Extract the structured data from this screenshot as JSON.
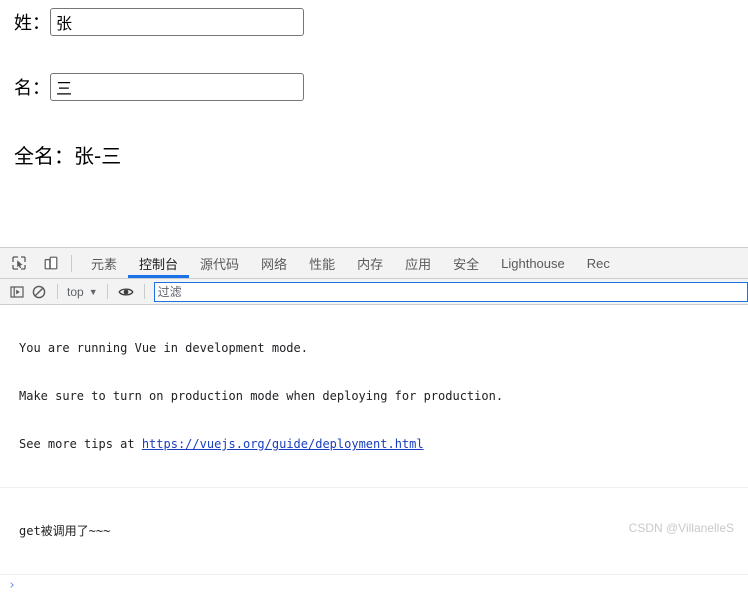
{
  "page": {
    "fields": [
      {
        "label": "姓：",
        "value": "张",
        "name": "surname"
      },
      {
        "label": "名：",
        "value": "三",
        "name": "givenname"
      }
    ],
    "fullname_text": "全名：张-三"
  },
  "devtools": {
    "toolbar_icons": [
      {
        "name": "inspect-element-icon",
        "title": "检查"
      },
      {
        "name": "device-toolbar-icon",
        "title": "切换设备工具栏"
      }
    ],
    "tabs": [
      {
        "label": "元素",
        "active": false,
        "cjk": true
      },
      {
        "label": "控制台",
        "active": true,
        "cjk": true
      },
      {
        "label": "源代码",
        "active": false,
        "cjk": true
      },
      {
        "label": "网络",
        "active": false,
        "cjk": true
      },
      {
        "label": "性能",
        "active": false,
        "cjk": true
      },
      {
        "label": "内存",
        "active": false,
        "cjk": true
      },
      {
        "label": "应用",
        "active": false,
        "cjk": true
      },
      {
        "label": "安全",
        "active": false,
        "cjk": true
      },
      {
        "label": "Lighthouse",
        "active": false,
        "cjk": false
      },
      {
        "label": "Rec",
        "active": false,
        "cjk": false
      }
    ],
    "console_toolbar": {
      "sidebar_toggle_name": "console-sidebar-toggle-icon",
      "clear_console_name": "clear-console-icon",
      "context_value": "top",
      "context_caret": "▼",
      "eye_icon_name": "live-expression-eye-icon",
      "filter_placeholder": "过滤",
      "filter_value": ""
    },
    "console_messages": [
      {
        "kind": "info",
        "lines": [
          "You are running Vue in development mode.",
          "Make sure to turn on production mode when deploying for production."
        ],
        "tail_prefix": "See more tips at ",
        "link": "https://vuejs.org/guide/deployment.html"
      },
      {
        "kind": "log",
        "lines": [
          "get被调用了~~~"
        ]
      }
    ],
    "prompt_caret": "›"
  },
  "watermark": "CSDN @VillanelleS",
  "colors": {
    "accent_blue": "#1a73e8",
    "link_blue": "#1a3ebf",
    "toolbar_bg": "#f3f3f3",
    "border_gray": "#cdcdcd",
    "prompt_blue": "#6b8afd"
  }
}
